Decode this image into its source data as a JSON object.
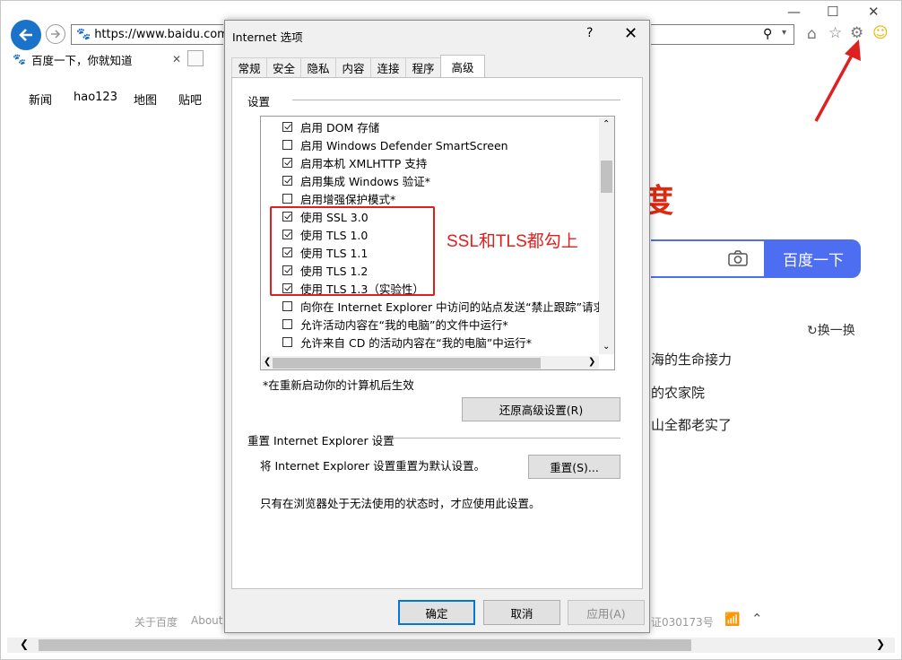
{
  "browser": {
    "address": "https://www.baidu.com/",
    "tab_title": "百度一下，你就知道",
    "nav_links": [
      "新闻",
      "hao123",
      "地图",
      "贴吧"
    ],
    "search_button": "百度一下",
    "refresh_label": "换一换",
    "hot_items": [
      "海的生命接力",
      "的农家院",
      "山全都老实了"
    ],
    "footer_left": [
      "关于百度",
      "About B"
    ],
    "footer_right": "证030173号"
  },
  "dialog": {
    "title": "Internet 选项",
    "help": "?",
    "close": "✕",
    "tabs": [
      "常规",
      "安全",
      "隐私",
      "内容",
      "连接",
      "程序",
      "高级"
    ],
    "active_tab": "高级",
    "settings_label": "设置",
    "options": [
      {
        "label": "启用 DOM 存储",
        "checked": true
      },
      {
        "label": "启用 Windows Defender SmartScreen",
        "checked": false
      },
      {
        "label": "启用本机 XMLHTTP 支持",
        "checked": true
      },
      {
        "label": "启用集成 Windows 验证*",
        "checked": true
      },
      {
        "label": "启用增强保护模式*",
        "checked": false
      },
      {
        "label": "使用 SSL 3.0",
        "checked": true
      },
      {
        "label": "使用 TLS 1.0",
        "checked": true
      },
      {
        "label": "使用 TLS 1.1",
        "checked": true
      },
      {
        "label": "使用 TLS 1.2",
        "checked": true
      },
      {
        "label": "使用 TLS 1.3（实验性）",
        "checked": true
      },
      {
        "label": "向你在 Internet Explorer 中访问的站点发送“禁止跟踪”请求*",
        "checked": false
      },
      {
        "label": "允许活动内容在“我的电脑”的文件中运行*",
        "checked": false
      },
      {
        "label": "允许来自 CD 的活动内容在“我的电脑”中运行*",
        "checked": false
      }
    ],
    "restart_note": "*在重新启动你的计算机后生效",
    "restore_button": "还原高级设置(R)",
    "reset_group_label": "重置 Internet Explorer 设置",
    "reset_desc": "将 Internet Explorer 设置重置为默认设置。",
    "reset_button": "重置(S)...",
    "reset_note": "只有在浏览器处于无法使用的状态时，才应使用此设置。",
    "ok_button": "确定",
    "cancel_button": "取消",
    "apply_button": "应用(A)"
  },
  "annotation": {
    "note": "SSL和TLS都勾上",
    "color": "#e0201f"
  }
}
